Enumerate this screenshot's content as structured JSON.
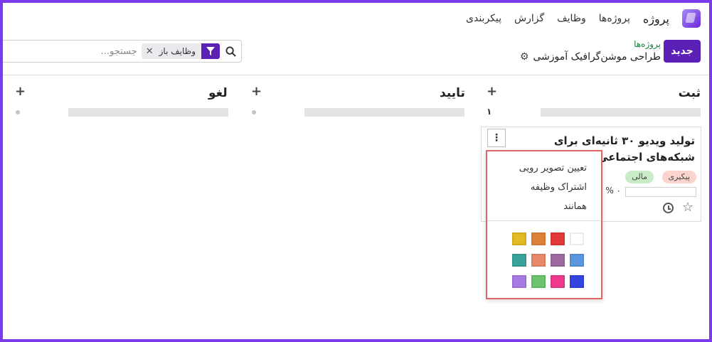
{
  "topnav": {
    "app_name": "پروژه",
    "items": [
      "پروژه‌ها",
      "وظایف",
      "گزارش",
      "پیکربندی"
    ]
  },
  "controls": {
    "new_button": "جدید",
    "breadcrumb_parent": "پروژه‌ها",
    "breadcrumb_current": "طراحی موشن‌گرافیک آموزشی",
    "search_facet": "وظایف باز",
    "search_placeholder": "جستجو..."
  },
  "columns": [
    {
      "title": "ثبت",
      "count": "۱"
    },
    {
      "title": "تایید",
      "count": "۰"
    },
    {
      "title": "لغو",
      "count": "۰"
    }
  ],
  "card": {
    "title": "تولید ویدیو ۳۰ ثانیه‌ای برای شبکه‌های اجتماعی",
    "tags": [
      "پیکیری",
      "مالی"
    ],
    "tag_colors": [
      "#fbd5cd",
      "#c9ecc6"
    ],
    "progress_text": "۰ %",
    "progress": 0,
    "menu_icon": "kebab-icon",
    "icons": [
      "star-icon",
      "clock-icon"
    ]
  },
  "dropdown": {
    "items": [
      "تعیین تصویر رویی",
      "اشتراک وظیفه",
      "همانند"
    ],
    "colors": [
      "#ffffff",
      "#e53935",
      "#e0813a",
      "#e3b924",
      "#5b96df",
      "#a06aa0",
      "#e88a6a",
      "#3aa39a",
      "#3347e0",
      "#ee3b8f",
      "#6cc46e",
      "#a77ae6"
    ]
  },
  "accent": "#5b21b6",
  "frame_color": "#7c3aed"
}
